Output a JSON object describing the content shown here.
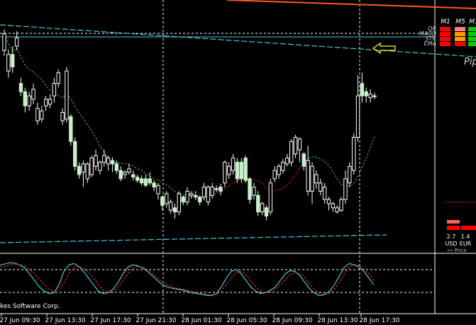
{
  "chart_data": [
    {
      "type": "candlestick",
      "x_labels": [
        "27 Jun 09:30",
        "27 Jun 13:30",
        "27 Jun 17:30",
        "27 Jun 21:30",
        "28 Jun 01:30",
        "28 Jun 05:30",
        "28 Jun 09:30",
        "28 Jun 13:30",
        "28 Jun 17:30"
      ],
      "candles": [
        {
          "o": 295,
          "c": 315,
          "h": 320,
          "l": 288
        },
        {
          "o": 270,
          "c": 290,
          "h": 296,
          "l": 262
        },
        {
          "o": 290,
          "c": 275,
          "h": 300,
          "l": 268
        },
        {
          "o": 300,
          "c": 310,
          "h": 318,
          "l": 295
        },
        {
          "o": 255,
          "c": 245,
          "h": 262,
          "l": 240
        },
        {
          "o": 245,
          "c": 228,
          "h": 250,
          "l": 220
        },
        {
          "o": 228,
          "c": 240,
          "h": 245,
          "l": 222
        },
        {
          "o": 236,
          "c": 248,
          "h": 255,
          "l": 230
        },
        {
          "o": 210,
          "c": 225,
          "h": 232,
          "l": 205
        },
        {
          "o": 212,
          "c": 222,
          "h": 228,
          "l": 208
        },
        {
          "o": 228,
          "c": 236,
          "h": 240,
          "l": 222
        },
        {
          "o": 230,
          "c": 236,
          "h": 242,
          "l": 225
        },
        {
          "o": 240,
          "c": 255,
          "h": 262,
          "l": 232
        },
        {
          "o": 255,
          "c": 268,
          "h": 272,
          "l": 250
        },
        {
          "o": 210,
          "c": 220,
          "h": 225,
          "l": 205
        },
        {
          "o": 212,
          "c": 270,
          "h": 275,
          "l": 208
        },
        {
          "o": 215,
          "c": 185,
          "h": 218,
          "l": 180
        },
        {
          "o": 185,
          "c": 155,
          "h": 190,
          "l": 150
        },
        {
          "o": 155,
          "c": 145,
          "h": 160,
          "l": 140
        },
        {
          "o": 148,
          "c": 158,
          "h": 162,
          "l": 130
        },
        {
          "o": 140,
          "c": 158,
          "h": 160,
          "l": 135
        },
        {
          "o": 145,
          "c": 165,
          "h": 168,
          "l": 142
        },
        {
          "o": 155,
          "c": 168,
          "h": 175,
          "l": 150
        },
        {
          "o": 150,
          "c": 160,
          "h": 162,
          "l": 145
        },
        {
          "o": 160,
          "c": 168,
          "h": 175,
          "l": 155
        },
        {
          "o": 158,
          "c": 165,
          "h": 168,
          "l": 150
        },
        {
          "o": 162,
          "c": 158,
          "h": 166,
          "l": 148
        },
        {
          "o": 158,
          "c": 150,
          "h": 162,
          "l": 146
        },
        {
          "o": 150,
          "c": 140,
          "h": 155,
          "l": 137
        },
        {
          "o": 145,
          "c": 148,
          "h": 150,
          "l": 140
        },
        {
          "o": 148,
          "c": 152,
          "h": 158,
          "l": 145
        },
        {
          "o": 145,
          "c": 142,
          "h": 150,
          "l": 138
        },
        {
          "o": 142,
          "c": 138,
          "h": 145,
          "l": 135
        },
        {
          "o": 140,
          "c": 135,
          "h": 144,
          "l": 132
        },
        {
          "o": 140,
          "c": 132,
          "h": 145,
          "l": 130
        },
        {
          "o": 140,
          "c": 135,
          "h": 148,
          "l": 132
        },
        {
          "o": 135,
          "c": 130,
          "h": 138,
          "l": 125
        },
        {
          "o": 122,
          "c": 132,
          "h": 135,
          "l": 115
        },
        {
          "o": 118,
          "c": 108,
          "h": 120,
          "l": 102
        },
        {
          "o": 110,
          "c": 122,
          "h": 125,
          "l": 105
        },
        {
          "o": 102,
          "c": 112,
          "h": 115,
          "l": 98
        },
        {
          "o": 105,
          "c": 100,
          "h": 110,
          "l": 92
        },
        {
          "o": 100,
          "c": 122,
          "h": 125,
          "l": 96
        },
        {
          "o": 118,
          "c": 112,
          "h": 120,
          "l": 108
        },
        {
          "o": 112,
          "c": 125,
          "h": 130,
          "l": 108
        },
        {
          "o": 120,
          "c": 122,
          "h": 125,
          "l": 116
        },
        {
          "o": 120,
          "c": 118,
          "h": 125,
          "l": 114
        },
        {
          "o": 118,
          "c": 112,
          "h": 120,
          "l": 108
        },
        {
          "o": 118,
          "c": 130,
          "h": 135,
          "l": 114
        },
        {
          "o": 112,
          "c": 130,
          "h": 132,
          "l": 108
        },
        {
          "o": 120,
          "c": 130,
          "h": 135,
          "l": 116
        },
        {
          "o": 128,
          "c": 128,
          "h": 132,
          "l": 124
        },
        {
          "o": 130,
          "c": 125,
          "h": 134,
          "l": 120
        },
        {
          "o": 135,
          "c": 160,
          "h": 162,
          "l": 130
        },
        {
          "o": 145,
          "c": 155,
          "h": 160,
          "l": 140
        },
        {
          "o": 150,
          "c": 165,
          "h": 170,
          "l": 145
        },
        {
          "o": 160,
          "c": 140,
          "h": 165,
          "l": 135
        },
        {
          "o": 160,
          "c": 140,
          "h": 165,
          "l": 135
        },
        {
          "o": 165,
          "c": 138,
          "h": 168,
          "l": 135
        },
        {
          "o": 140,
          "c": 115,
          "h": 142,
          "l": 110
        },
        {
          "o": 120,
          "c": 130,
          "h": 135,
          "l": 115
        },
        {
          "o": 120,
          "c": 100,
          "h": 125,
          "l": 95
        },
        {
          "o": 100,
          "c": 110,
          "h": 112,
          "l": 96
        },
        {
          "o": 105,
          "c": 95,
          "h": 108,
          "l": 90
        },
        {
          "o": 100,
          "c": 135,
          "h": 140,
          "l": 96
        },
        {
          "o": 140,
          "c": 150,
          "h": 155,
          "l": 136
        },
        {
          "o": 145,
          "c": 155,
          "h": 158,
          "l": 140
        },
        {
          "o": 150,
          "c": 160,
          "h": 164,
          "l": 146
        },
        {
          "o": 158,
          "c": 165,
          "h": 170,
          "l": 155
        },
        {
          "o": 160,
          "c": 185,
          "h": 188,
          "l": 155
        },
        {
          "o": 170,
          "c": 190,
          "h": 193,
          "l": 165
        },
        {
          "o": 175,
          "c": 188,
          "h": 190,
          "l": 160
        },
        {
          "o": 170,
          "c": 155,
          "h": 172,
          "l": 150
        },
        {
          "o": 125,
          "c": 162,
          "h": 180,
          "l": 120
        },
        {
          "o": 125,
          "c": 155,
          "h": 160,
          "l": 110
        },
        {
          "o": 135,
          "c": 145,
          "h": 150,
          "l": 128
        },
        {
          "o": 125,
          "c": 135,
          "h": 140,
          "l": 120
        },
        {
          "o": 115,
          "c": 130,
          "h": 135,
          "l": 110
        },
        {
          "o": 110,
          "c": 115,
          "h": 118,
          "l": 102
        },
        {
          "o": 105,
          "c": 110,
          "h": 112,
          "l": 100
        },
        {
          "o": 100,
          "c": 105,
          "h": 108,
          "l": 98
        },
        {
          "o": 102,
          "c": 115,
          "h": 118,
          "l": 100
        },
        {
          "o": 115,
          "c": 140,
          "h": 150,
          "l": 110
        },
        {
          "o": 135,
          "c": 155,
          "h": 160,
          "l": 130
        },
        {
          "o": 150,
          "c": 190,
          "h": 195,
          "l": 145
        },
        {
          "o": 190,
          "c": 240,
          "h": 265,
          "l": 185
        },
        {
          "o": 255,
          "c": 240,
          "h": 268,
          "l": 232
        },
        {
          "o": 245,
          "c": 240,
          "h": 250,
          "l": 232
        },
        {
          "o": 238,
          "c": 242,
          "h": 248,
          "l": 232
        },
        {
          "o": 240,
          "c": 240,
          "h": 244,
          "l": 236
        }
      ],
      "panel_labels": [
        "QR",
        "MACD",
        "STR",
        "EMA"
      ],
      "timeframes": [
        "M1",
        "M5",
        "M1"
      ],
      "status_grid": [
        [
          "#ff0000",
          "#ff8080",
          "#00cc00"
        ],
        [
          "#ff0000",
          "#ff9900",
          "#00cc00"
        ],
        [
          "#ff0000",
          "#ff9900",
          "#00cc00"
        ],
        [
          "#ff0000",
          "#ff0000",
          "#00cc00"
        ]
      ],
      "pip_label": "Pip",
      "currency_values": [
        "2.7",
        "1.4"
      ],
      "currency_labels": [
        "USD",
        "EUR"
      ],
      "price_label": "»» Price",
      "watermark": "kes Software Corp.",
      "colors": {
        "background": "#000000",
        "candle_up": "#ffffff",
        "candle_down": "#c8f0c8",
        "channel": "#4fc3d9",
        "top_line": "#ff5a1f",
        "ema_green": "#4caf50",
        "ema_red": "#ff2020",
        "stoch_main": "#4fc3d9",
        "stoch_signal": "#ff3030",
        "arrow": "#ffff00"
      }
    },
    {
      "type": "line",
      "name": "stochastic",
      "main": [
        85,
        87,
        90,
        89,
        85,
        78,
        65,
        50,
        35,
        25,
        20,
        22,
        40,
        70,
        85,
        88,
        82,
        70,
        55,
        40,
        25,
        20,
        22,
        30,
        45,
        65,
        80,
        85,
        83,
        78,
        70,
        60,
        50,
        40,
        35,
        32,
        30,
        28,
        25,
        22,
        20,
        18,
        16,
        15,
        20,
        35,
        55,
        70,
        75,
        65,
        50,
        35,
        25,
        20,
        22,
        28,
        35,
        50,
        65,
        72,
        70,
        60,
        45,
        30,
        20,
        15,
        18,
        25,
        40,
        60,
        80,
        88,
        85,
        80,
        70,
        55,
        40
      ],
      "signal": [
        80,
        82,
        85,
        87,
        86,
        82,
        75,
        65,
        52,
        40,
        30,
        25,
        28,
        45,
        65,
        78,
        82,
        78,
        68,
        55,
        40,
        28,
        22,
        24,
        35,
        50,
        65,
        77,
        82,
        80,
        74,
        65,
        56,
        47,
        40,
        35,
        32,
        30,
        28,
        25,
        22,
        20,
        18,
        17,
        18,
        25,
        40,
        55,
        68,
        70,
        62,
        48,
        35,
        26,
        22,
        24,
        30,
        40,
        52,
        62,
        68,
        65,
        55,
        40,
        28,
        20,
        18,
        20,
        30,
        45,
        65,
        80,
        86,
        84,
        76,
        64,
        50
      ]
    }
  ]
}
